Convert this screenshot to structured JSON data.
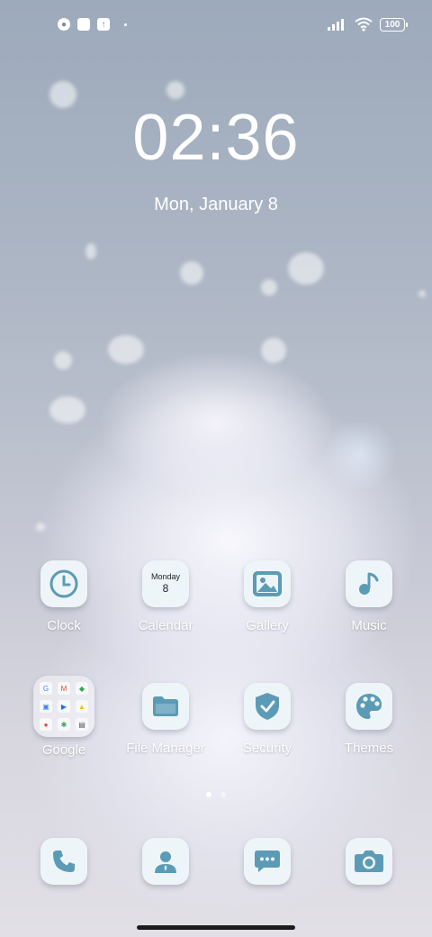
{
  "status_bar": {
    "icons": [
      "notification-icon",
      "square-icon",
      "upload-icon"
    ],
    "battery": "100"
  },
  "lockscreen": {
    "time": "02:36",
    "date": "Mon, January 8"
  },
  "apps_row1": [
    {
      "label": "Clock",
      "icon": "clock-icon"
    },
    {
      "label": "Calendar",
      "icon": "calendar-icon",
      "day_name": "Monday",
      "day_number": "8"
    },
    {
      "label": "Gallery",
      "icon": "gallery-icon"
    },
    {
      "label": "Music",
      "icon": "music-icon"
    }
  ],
  "apps_row2": [
    {
      "label": "Google",
      "icon": "google-folder-icon"
    },
    {
      "label": "File Manager",
      "icon": "folder-icon"
    },
    {
      "label": "Security",
      "icon": "shield-icon"
    },
    {
      "label": "Themes",
      "icon": "palette-icon"
    }
  ],
  "dock": [
    {
      "icon": "phone-icon"
    },
    {
      "icon": "contacts-icon"
    },
    {
      "icon": "messages-icon"
    },
    {
      "icon": "camera-icon"
    }
  ],
  "page_indicator": {
    "pages": 2,
    "current": 1
  },
  "colors": {
    "icon_fg": "#5c9bb6",
    "icon_bg": "#eef5f8"
  }
}
